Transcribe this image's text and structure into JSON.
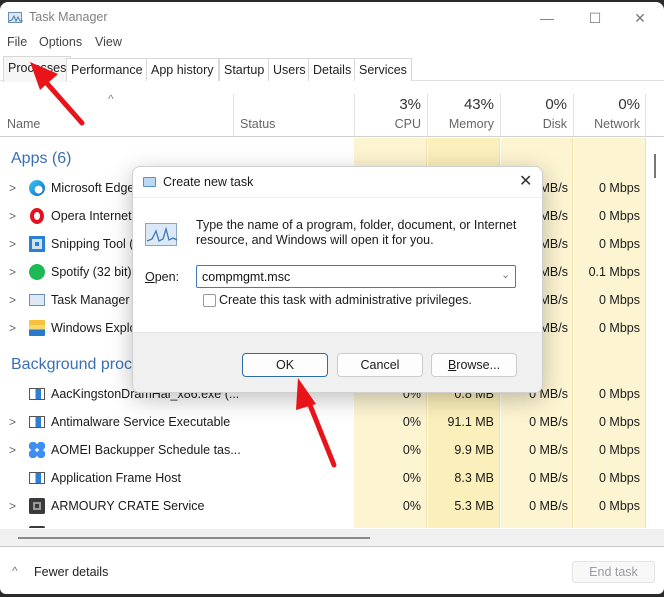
{
  "window": {
    "title": "Task Manager",
    "controls": {
      "minimize": "—",
      "maximize": "☐",
      "close": "✕"
    }
  },
  "menu": [
    "File",
    "Options",
    "View"
  ],
  "tabs": [
    {
      "label": "Processes",
      "active": true
    },
    {
      "label": "Performance"
    },
    {
      "label": "App history"
    },
    {
      "label": "Startup"
    },
    {
      "label": "Users"
    },
    {
      "label": "Details"
    },
    {
      "label": "Services"
    }
  ],
  "columns": {
    "name": "Name",
    "status": "Status",
    "cpu": {
      "pct": "3%",
      "label": "CPU"
    },
    "memory": {
      "pct": "43%",
      "label": "Memory"
    },
    "disk": {
      "pct": "0%",
      "label": "Disk"
    },
    "network": {
      "pct": "0%",
      "label": "Network"
    }
  },
  "groups": {
    "apps": "Apps (6)",
    "background": "Background processes"
  },
  "apps": [
    {
      "name": "Microsoft Edge",
      "disk": "MB/s",
      "network": "0 Mbps"
    },
    {
      "name": "Opera Internet Browser",
      "disk": "MB/s",
      "network": "0 Mbps"
    },
    {
      "name": "Snipping Tool (2)",
      "disk": "MB/s",
      "network": "0 Mbps"
    },
    {
      "name": "Spotify (32 bit)",
      "disk": "MB/s",
      "network": "0.1 Mbps"
    },
    {
      "name": "Task Manager (2)",
      "disk": "MB/s",
      "network": "0 Mbps"
    },
    {
      "name": "Windows Explorer",
      "disk": "MB/s",
      "network": "0 Mbps"
    }
  ],
  "background": [
    {
      "name": "AacKingstonDramHal_x86.exe (...",
      "cpu": "0%",
      "memory": "0.8 MB",
      "disk": "0 MB/s",
      "network": "0 Mbps"
    },
    {
      "name": "Antimalware Service Executable",
      "cpu": "0%",
      "memory": "91.1 MB",
      "disk": "0 MB/s",
      "network": "0 Mbps"
    },
    {
      "name": "AOMEI Backupper Schedule tas...",
      "cpu": "0%",
      "memory": "9.9 MB",
      "disk": "0 MB/s",
      "network": "0 Mbps"
    },
    {
      "name": "Application Frame Host",
      "cpu": "0%",
      "memory": "8.3 MB",
      "disk": "0 MB/s",
      "network": "0 Mbps"
    },
    {
      "name": "ARMOURY CRATE Service",
      "cpu": "0%",
      "memory": "5.3 MB",
      "disk": "0 MB/s",
      "network": "0 Mbps"
    }
  ],
  "footer": {
    "fewer_details": "Fewer details",
    "end_task": "End task"
  },
  "dialog": {
    "title": "Create new task",
    "close": "✕",
    "description": "Type the name of a program, folder, document, or Internet resource, and Windows will open it for you.",
    "open_label": "Open:",
    "open_value": "compmgmt.msc",
    "admin_checkbox": "Create this task with administrative privileges.",
    "admin_checked": false,
    "ok": "OK",
    "cancel": "Cancel",
    "browse": "Browse..."
  },
  "colors": {
    "accent": "#3a6fb5",
    "heat_light": "#fdf5d6",
    "heat_mid": "#fbeeb8",
    "annotation_arrow": "#e8141a"
  }
}
